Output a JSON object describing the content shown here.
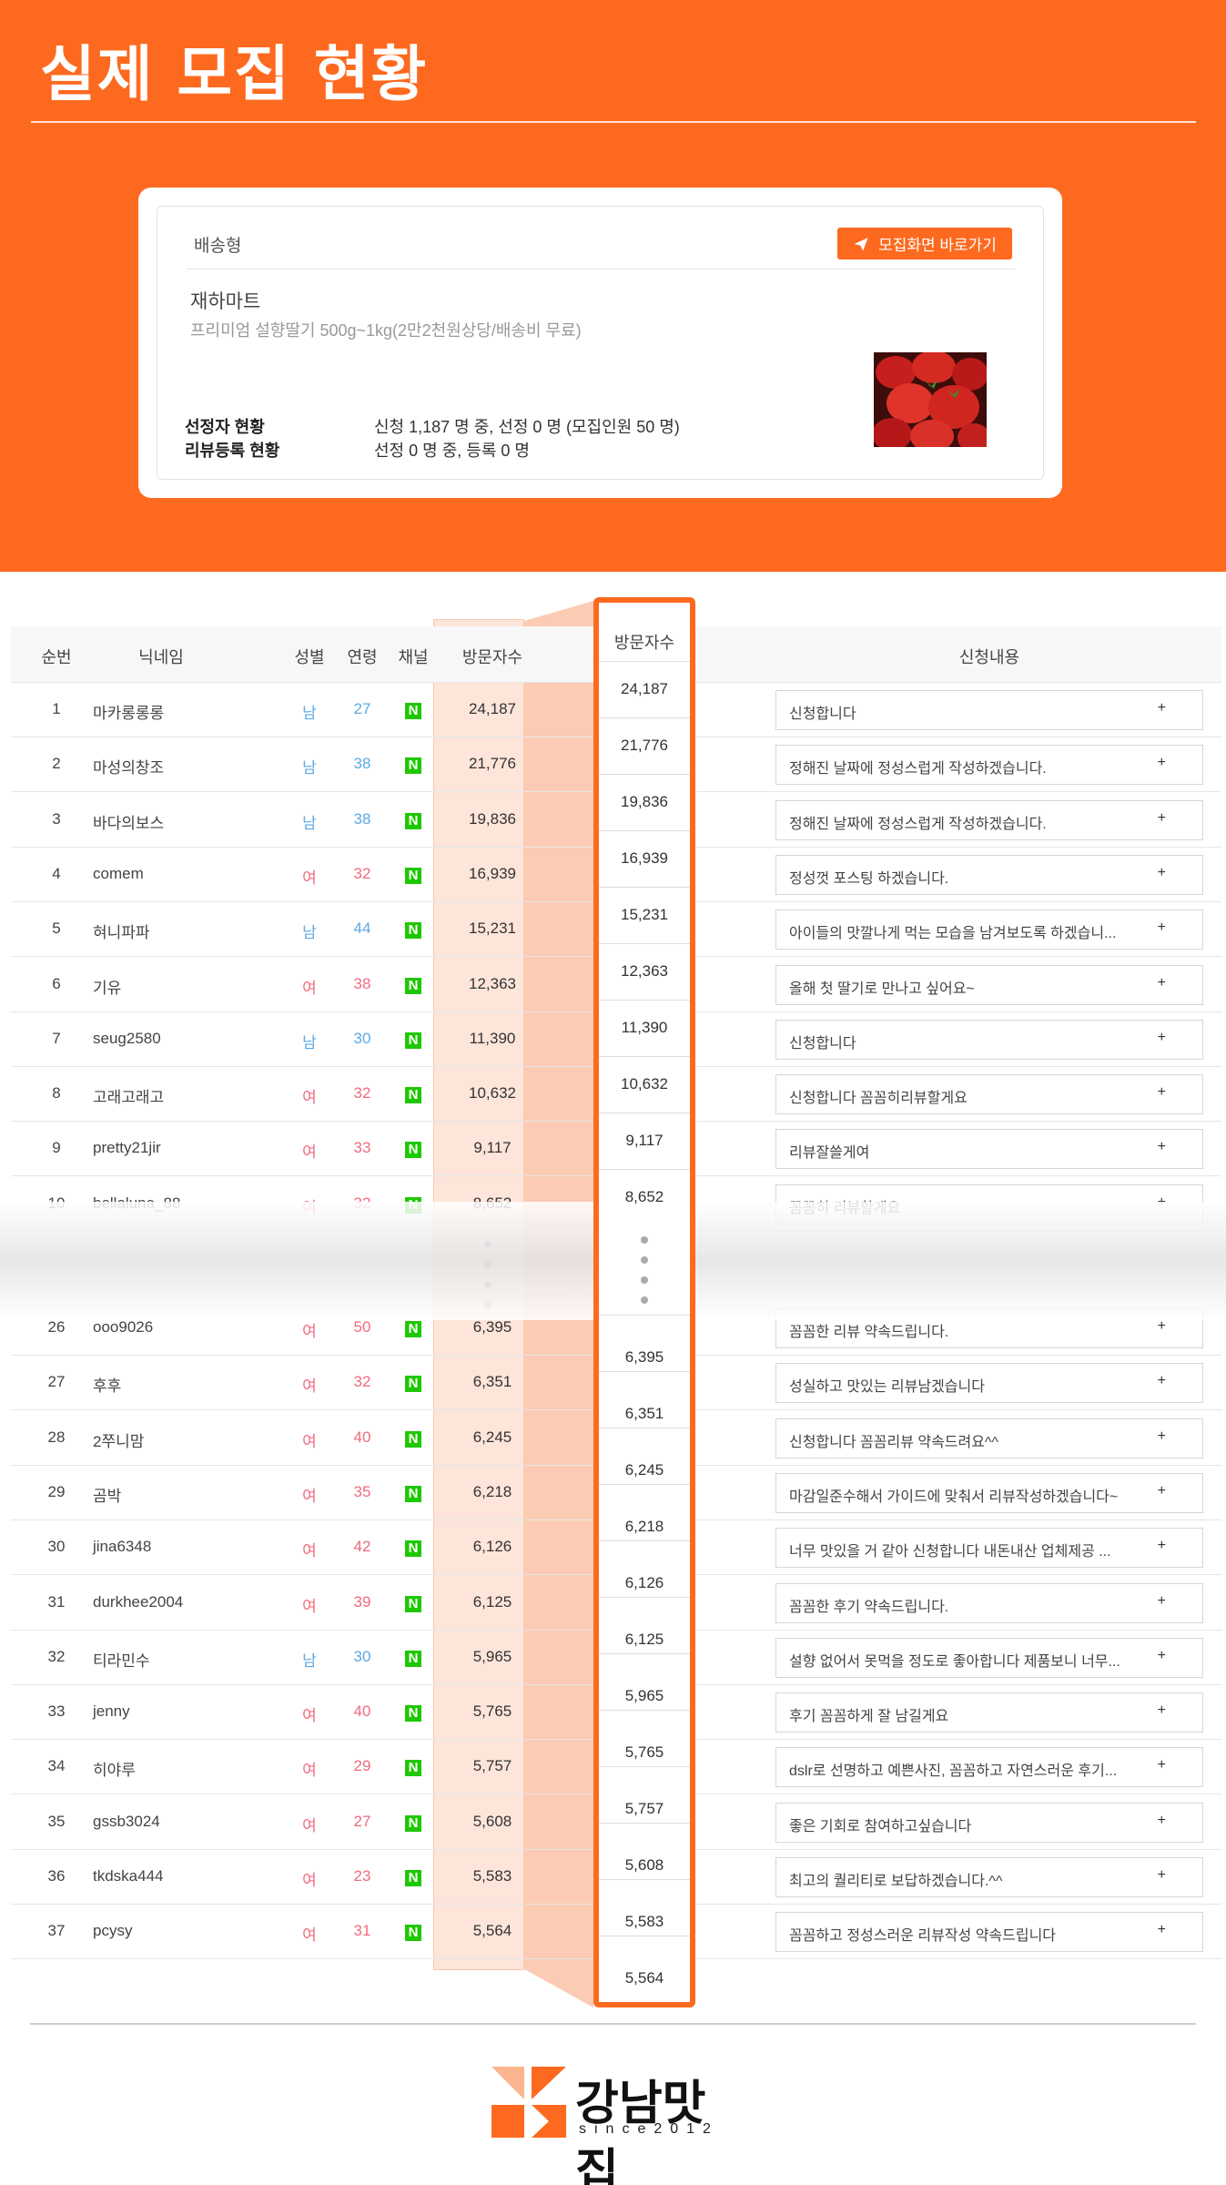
{
  "header": {
    "title": "실제 모집 현황"
  },
  "card": {
    "type": "배송형",
    "goto_button": "모집화면 바로가기",
    "store": "재하마트",
    "product": "프리미엄 설향딸기 500g~1kg(2만2천원상당/배송비 무료)",
    "stats": [
      {
        "label": "선정자 현황",
        "value": "신청 1,187 명 중, 선정 0 명 (모집인원 50 명)"
      },
      {
        "label": "리뷰등록 현황",
        "value": "선정 0 명 중, 등록 0 명"
      }
    ]
  },
  "table": {
    "headers": {
      "rank": "순번",
      "nick": "닉네임",
      "gender": "성별",
      "age": "연령",
      "channel": "채널",
      "visits": "방문자수",
      "apply": "신청내용"
    },
    "rows": [
      {
        "rank": "1",
        "nick": "마카롱롱롱",
        "gender": "남",
        "age": "27",
        "visits": "24,187",
        "apply": "신청합니다"
      },
      {
        "rank": "2",
        "nick": "마성의창조",
        "gender": "남",
        "age": "38",
        "visits": "21,776",
        "apply": "정해진 날짜에 정성스럽게 작성하겠습니다."
      },
      {
        "rank": "3",
        "nick": "바다의보스",
        "gender": "남",
        "age": "38",
        "visits": "19,836",
        "apply": "정해진 날짜에 정성스럽게 작성하겠습니다."
      },
      {
        "rank": "4",
        "nick": "comem",
        "gender": "여",
        "age": "32",
        "visits": "16,939",
        "apply": "정성껏 포스팅 하겠습니다."
      },
      {
        "rank": "5",
        "nick": "혀니파파",
        "gender": "남",
        "age": "44",
        "visits": "15,231",
        "apply": "아이들의 맛깔나게 먹는 모습을 남겨보도록 하겠습니..."
      },
      {
        "rank": "6",
        "nick": "기유",
        "gender": "여",
        "age": "38",
        "visits": "12,363",
        "apply": "올해 첫 딸기로 만나고 싶어요~"
      },
      {
        "rank": "7",
        "nick": "seug2580",
        "gender": "남",
        "age": "30",
        "visits": "11,390",
        "apply": "신청합니다"
      },
      {
        "rank": "8",
        "nick": "고래고래고",
        "gender": "여",
        "age": "32",
        "visits": "10,632",
        "apply": "신청합니다 꼼꼼히리뷰할게요"
      },
      {
        "rank": "9",
        "nick": "pretty21jir",
        "gender": "여",
        "age": "33",
        "visits": "9,117",
        "apply": "리뷰잘쓸게여"
      },
      {
        "rank": "10",
        "nick": "bellaluna_88",
        "gender": "여",
        "age": "32",
        "visits": "8,652",
        "apply": "꼼꼼히 리뷰할게요"
      },
      {
        "rank": "26",
        "nick": "ooo9026",
        "gender": "여",
        "age": "50",
        "visits": "6,395",
        "apply": "꼼꼼한 리뷰 약속드립니다."
      },
      {
        "rank": "27",
        "nick": "후후",
        "gender": "여",
        "age": "32",
        "visits": "6,351",
        "apply": "성실하고 맛있는 리뷰남겠습니다"
      },
      {
        "rank": "28",
        "nick": "2쭈니맘",
        "gender": "여",
        "age": "40",
        "visits": "6,245",
        "apply": "신청합니다 꼼꼼리뷰 약속드려요^^"
      },
      {
        "rank": "29",
        "nick": "곰박",
        "gender": "여",
        "age": "35",
        "visits": "6,218",
        "apply": "마감일준수해서 가이드에 맞춰서 리뷰작성하겠습니다~"
      },
      {
        "rank": "30",
        "nick": "jina6348",
        "gender": "여",
        "age": "42",
        "visits": "6,126",
        "apply": "너무 맛있을 거 같아 신청합니다 내돈내산 업체제공 ..."
      },
      {
        "rank": "31",
        "nick": "durkhee2004",
        "gender": "여",
        "age": "39",
        "visits": "6,125",
        "apply": "꼼꼼한 후기 약속드립니다."
      },
      {
        "rank": "32",
        "nick": "티라민수",
        "gender": "남",
        "age": "30",
        "visits": "5,965",
        "apply": "설향 없어서 못먹을 정도로 좋아합니다 제품보니 너무..."
      },
      {
        "rank": "33",
        "nick": "jenny",
        "gender": "여",
        "age": "40",
        "visits": "5,765",
        "apply": "후기 꼼꼼하게 잘 남길게요"
      },
      {
        "rank": "34",
        "nick": "히야루",
        "gender": "여",
        "age": "29",
        "visits": "5,757",
        "apply": "dslr로 선명하고 예쁜사진, 꼼꼼하고 자연스러운 후기..."
      },
      {
        "rank": "35",
        "nick": "gssb3024",
        "gender": "여",
        "age": "27",
        "visits": "5,608",
        "apply": "좋은 기회로 참여하고싶습니다"
      },
      {
        "rank": "36",
        "nick": "tkdska444",
        "gender": "여",
        "age": "23",
        "visits": "5,583",
        "apply": "최고의 퀄리티로 보답하겠습니다.^^"
      },
      {
        "rank": "37",
        "nick": "pcysy",
        "gender": "여",
        "age": "31",
        "visits": "5,564",
        "apply": "꼼꼼하고 정성스러운 리뷰작성 약속드립니다"
      }
    ],
    "channel_icon": "naver-blog-icon",
    "plus": "+"
  },
  "zoom": {
    "header": "방문자수"
  },
  "footer": {
    "logo_name": "강남맛집",
    "logo_since": "since2012"
  },
  "colors": {
    "accent": "#fd6a1f",
    "male": "#5aa9e6",
    "female": "#f06a7e",
    "naver": "#1ec800"
  }
}
